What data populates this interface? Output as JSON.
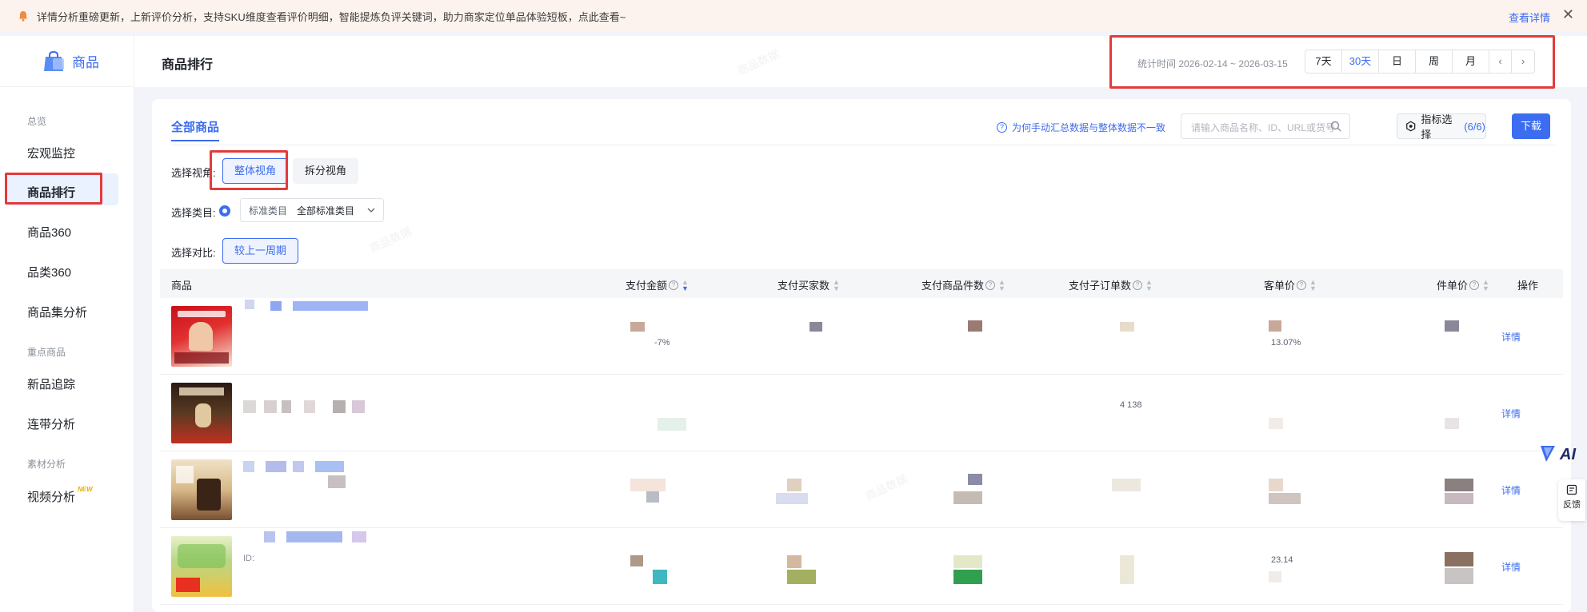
{
  "notice": {
    "text": "详情分析重磅更新，上新评价分析，支持SKU维度查看评价明细，智能提炼负评关键词，助力商家定位单品体验短板，点此查看~",
    "link": "查看详情",
    "close": "✕"
  },
  "sidebar": {
    "brand": "商品",
    "groups": [
      "总览",
      "重点商品",
      "素材分析"
    ],
    "items": [
      "宏观监控",
      "商品排行",
      "商品360",
      "品类360",
      "商品集分析",
      "新品追踪",
      "连带分析",
      "视频分析"
    ],
    "new_badge": "NEW",
    "active_item": "商品排行"
  },
  "header": {
    "title": "商品排行",
    "stat_time": "统计时间 2026-02-14 ~ 2026-03-15",
    "periods": [
      "7天",
      "30天",
      "日",
      "周",
      "月"
    ],
    "active_period": "30天",
    "prev": "‹",
    "next": "›"
  },
  "toolbar": {
    "tab": "全部商品",
    "help": "为何手动汇总数据与整体数据不一致",
    "search_placeholder": "请输入商品名称、ID、URL或货号",
    "metric_label": "指标选择",
    "metric_count": "(6/6)",
    "download": "下载"
  },
  "filters": {
    "view_label": "选择视角:",
    "view_options": [
      "整体视角",
      "拆分视角"
    ],
    "category_label": "选择类目:",
    "category_key": "标准类目",
    "category_value": "全部标准类目",
    "compare_label": "选择对比:",
    "compare_value": "较上一周期"
  },
  "table": {
    "columns": [
      "商品",
      "支付金额",
      "支付买家数",
      "支付商品件数",
      "支付子订单数",
      "客单价",
      "件单价",
      "操作"
    ],
    "rows": [
      {
        "action": "详情",
        "fragments": [
          "-7%",
          "13.07%"
        ]
      },
      {
        "action": "详情",
        "fragments": [
          "4 138"
        ]
      },
      {
        "action": "详情",
        "fragments": []
      },
      {
        "action": "详情",
        "fragments": [
          "ID:",
          "23.14"
        ]
      }
    ]
  },
  "floating": {
    "ai": "AI",
    "feedback": "反馈"
  },
  "colors": {
    "primary": "#3c6cf0",
    "annotation": "#e23b3b",
    "notice_bg": "#fdf3ee"
  }
}
